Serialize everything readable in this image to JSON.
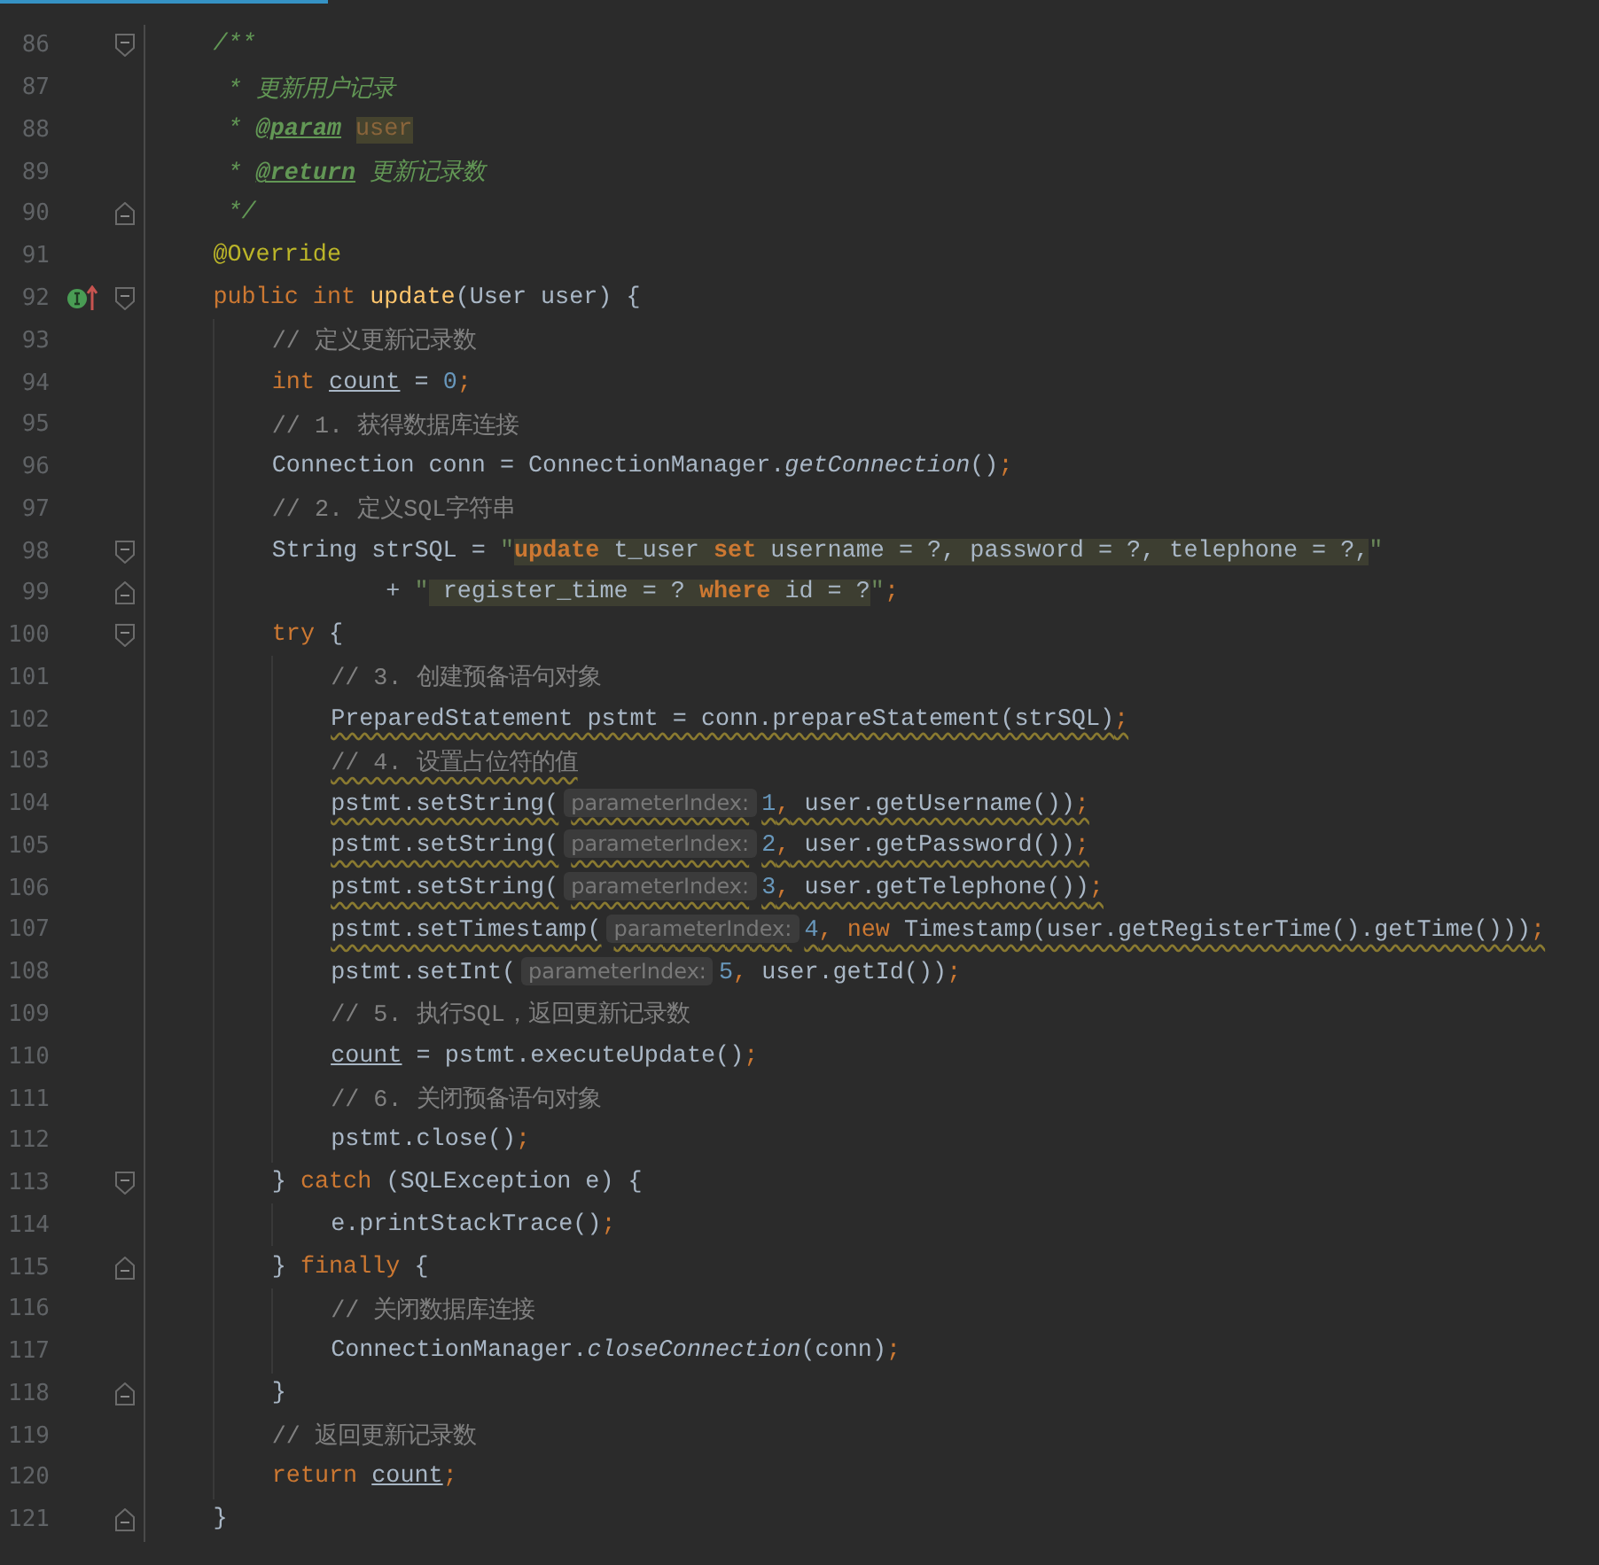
{
  "editor": {
    "lines": [
      {
        "number": "86",
        "fold": {
          "kind": "start"
        },
        "tokens": [
          {
            "kind": "doc",
            "text": "/**"
          }
        ]
      },
      {
        "number": "87",
        "tokens": [
          {
            "kind": "doc",
            "text": " * 更新用户记录"
          }
        ]
      },
      {
        "number": "88",
        "tokens": [
          {
            "kind": "doc",
            "text": " * "
          },
          {
            "kind": "doctag",
            "text": "@param"
          },
          {
            "kind": "docref",
            "text": "user"
          }
        ]
      },
      {
        "number": "89",
        "tokens": [
          {
            "kind": "doc",
            "text": " * "
          },
          {
            "kind": "doctag",
            "text": "@return"
          },
          {
            "kind": "doc",
            "text": " 更新记录数"
          }
        ]
      },
      {
        "number": "90",
        "fold": {
          "kind": "end"
        },
        "tokens": [
          {
            "kind": "doc",
            "text": " */"
          }
        ]
      },
      {
        "number": "91",
        "tokens": [
          {
            "kind": "ann",
            "text": "@Override"
          }
        ]
      },
      {
        "number": "92",
        "fold": {
          "kind": "start"
        },
        "gutter_icon": {
          "kind": "implements"
        },
        "tokens": [
          {
            "kind": "kw",
            "text": "public int "
          },
          {
            "kind": "fn",
            "text": "update"
          },
          {
            "kind": "plain",
            "text": "(User user) {"
          }
        ],
        "children": [
          {
            "number": "93",
            "tokens": [
              {
                "kind": "comment",
                "text": "// 定义更新记录数"
              }
            ]
          },
          {
            "number": "94",
            "tokens": [
              {
                "kind": "kw",
                "text": "int "
              },
              {
                "kind": "var",
                "text": "count"
              },
              {
                "kind": "plain",
                "text": " = "
              },
              {
                "kind": "num",
                "text": "0"
              },
              {
                "kind": "semi",
                "text": ";"
              }
            ]
          },
          {
            "number": "95",
            "tokens": [
              {
                "kind": "comment",
                "text": "// 1. 获得数据库连接"
              }
            ]
          },
          {
            "number": "96",
            "tokens": [
              {
                "kind": "plain",
                "text": "Connection conn = ConnectionManager."
              },
              {
                "kind": "static",
                "text": "getConnection"
              },
              {
                "kind": "plain",
                "text": "()"
              },
              {
                "kind": "semi",
                "text": ";"
              }
            ]
          },
          {
            "number": "97",
            "tokens": [
              {
                "kind": "comment",
                "text": "// 2. 定义SQL字符串"
              }
            ]
          },
          {
            "number": "98",
            "fold": {
              "kind": "start"
            },
            "tokens": [
              {
                "kind": "plain",
                "text": "String strSQL = "
              },
              {
                "kind": "str",
                "text": "\""
              },
              {
                "kind": "sqlkw",
                "text": "update"
              },
              {
                "kind": "sql",
                "text": " t_user "
              },
              {
                "kind": "sqlkw",
                "text": "set"
              },
              {
                "kind": "sql",
                "text": " username = ?, password = ?, telephone = ?,"
              },
              {
                "kind": "str",
                "text": "\""
              }
            ]
          },
          {
            "number": "99",
            "fold": {
              "kind": "end"
            },
            "tokens": [
              {
                "kind": "plain",
                "text": "        + "
              },
              {
                "kind": "str",
                "text": "\""
              },
              {
                "kind": "sql",
                "text": " register_time = ? "
              },
              {
                "kind": "sqlkw",
                "text": "where"
              },
              {
                "kind": "sql",
                "text": " id = ?"
              },
              {
                "kind": "str",
                "text": "\""
              },
              {
                "kind": "semi",
                "text": ";"
              }
            ]
          },
          {
            "number": "100",
            "fold": {
              "kind": "start"
            },
            "tokens": [
              {
                "kind": "kw",
                "text": "try"
              },
              {
                "kind": "plain",
                "text": " {"
              }
            ],
            "children": [
              {
                "number": "101",
                "tokens": [
                  {
                    "kind": "comment",
                    "text": "// 3. 创建预备语句对象"
                  }
                ]
              },
              {
                "number": "102",
                "warning": true,
                "tokens": [
                  {
                    "kind": "plain",
                    "text": "PreparedStatement pstmt = conn.prepareStatement(strSQL)"
                  },
                  {
                    "kind": "semi",
                    "text": ";"
                  }
                ]
              },
              {
                "number": "103",
                "warning": true,
                "tokens": [
                  {
                    "kind": "comment",
                    "text": "// 4. 设置占位符的值"
                  }
                ]
              },
              {
                "number": "104",
                "warning": true,
                "tokens": [
                  {
                    "kind": "plain",
                    "text": "pstmt.setString("
                  },
                  {
                    "kind": "hint",
                    "text": "parameterIndex:"
                  },
                  {
                    "kind": "num",
                    "text": "1"
                  },
                  {
                    "kind": "semi",
                    "text": ","
                  },
                  {
                    "kind": "plain",
                    "text": " user.getUsername())"
                  },
                  {
                    "kind": "semi",
                    "text": ";"
                  }
                ]
              },
              {
                "number": "105",
                "warning": true,
                "tokens": [
                  {
                    "kind": "plain",
                    "text": "pstmt.setString("
                  },
                  {
                    "kind": "hint",
                    "text": "parameterIndex:"
                  },
                  {
                    "kind": "num",
                    "text": "2"
                  },
                  {
                    "kind": "semi",
                    "text": ","
                  },
                  {
                    "kind": "plain",
                    "text": " user.getPassword())"
                  },
                  {
                    "kind": "semi",
                    "text": ";"
                  }
                ]
              },
              {
                "number": "106",
                "warning": true,
                "tokens": [
                  {
                    "kind": "plain",
                    "text": "pstmt.setString("
                  },
                  {
                    "kind": "hint",
                    "text": "parameterIndex:"
                  },
                  {
                    "kind": "num",
                    "text": "3"
                  },
                  {
                    "kind": "semi",
                    "text": ","
                  },
                  {
                    "kind": "plain",
                    "text": " user.getTelephone())"
                  },
                  {
                    "kind": "semi",
                    "text": ";"
                  }
                ]
              },
              {
                "number": "107",
                "warning": true,
                "tokens": [
                  {
                    "kind": "plain",
                    "text": "pstmt.setTimestamp("
                  },
                  {
                    "kind": "hint",
                    "text": "parameterIndex:"
                  },
                  {
                    "kind": "num",
                    "text": "4"
                  },
                  {
                    "kind": "semi",
                    "text": ", "
                  },
                  {
                    "kind": "kw",
                    "text": "new"
                  },
                  {
                    "kind": "plain",
                    "text": " Timestamp(user.getRegisterTime().getTime()))"
                  },
                  {
                    "kind": "semi",
                    "text": ";"
                  }
                ]
              },
              {
                "number": "108",
                "warning": false,
                "tokens": [
                  {
                    "kind": "plain",
                    "text": "pstmt.setInt("
                  },
                  {
                    "kind": "hint",
                    "text": "parameterIndex:"
                  },
                  {
                    "kind": "num",
                    "text": "5"
                  },
                  {
                    "kind": "semi",
                    "text": ","
                  },
                  {
                    "kind": "plain",
                    "text": " user.getId())"
                  },
                  {
                    "kind": "semi",
                    "text": ";"
                  }
                ]
              },
              {
                "number": "109",
                "tokens": [
                  {
                    "kind": "comment",
                    "text": "// 5. 执行SQL，返回更新记录数"
                  }
                ]
              },
              {
                "number": "110",
                "tokens": [
                  {
                    "kind": "var",
                    "text": "count"
                  },
                  {
                    "kind": "plain",
                    "text": " = pstmt.executeUpdate()"
                  },
                  {
                    "kind": "semi",
                    "text": ";"
                  }
                ]
              },
              {
                "number": "111",
                "tokens": [
                  {
                    "kind": "comment",
                    "text": "// 6. 关闭预备语句对象"
                  }
                ]
              },
              {
                "number": "112",
                "tokens": [
                  {
                    "kind": "plain",
                    "text": "pstmt.close()"
                  },
                  {
                    "kind": "semi",
                    "text": ";"
                  }
                ]
              }
            ]
          },
          {
            "number": "113",
            "fold": {
              "kind": "start"
            },
            "tokens": [
              {
                "kind": "plain",
                "text": "} "
              },
              {
                "kind": "kw",
                "text": "catch"
              },
              {
                "kind": "plain",
                "text": " (SQLException e) {"
              }
            ],
            "children": [
              {
                "number": "114",
                "tokens": [
                  {
                    "kind": "plain",
                    "text": "e.printStackTrace()"
                  },
                  {
                    "kind": "semi",
                    "text": ";"
                  }
                ]
              }
            ]
          },
          {
            "number": "115",
            "fold": {
              "kind": "end"
            },
            "tokens": [
              {
                "kind": "plain",
                "text": "} "
              },
              {
                "kind": "kw",
                "text": "finally"
              },
              {
                "kind": "plain",
                "text": " {"
              }
            ],
            "children": [
              {
                "number": "116",
                "tokens": [
                  {
                    "kind": "comment",
                    "text": "// 关闭数据库连接"
                  }
                ]
              },
              {
                "number": "117",
                "tokens": [
                  {
                    "kind": "plain",
                    "text": "ConnectionManager."
                  },
                  {
                    "kind": "static",
                    "text": "closeConnection"
                  },
                  {
                    "kind": "plain",
                    "text": "(conn)"
                  },
                  {
                    "kind": "semi",
                    "text": ";"
                  }
                ]
              }
            ]
          },
          {
            "number": "118",
            "fold": {
              "kind": "end"
            },
            "tokens": [
              {
                "kind": "plain",
                "text": "}"
              }
            ]
          },
          {
            "number": "119",
            "tokens": [
              {
                "kind": "comment",
                "text": "// 返回更新记录数"
              }
            ]
          },
          {
            "number": "120",
            "tokens": [
              {
                "kind": "kw",
                "text": "return "
              },
              {
                "kind": "var",
                "text": "count"
              },
              {
                "kind": "semi",
                "text": ";"
              }
            ]
          }
        ]
      },
      {
        "number": "121",
        "fold": {
          "kind": "end"
        },
        "tokens": [
          {
            "kind": "plain",
            "text": "}"
          }
        ]
      }
    ]
  }
}
